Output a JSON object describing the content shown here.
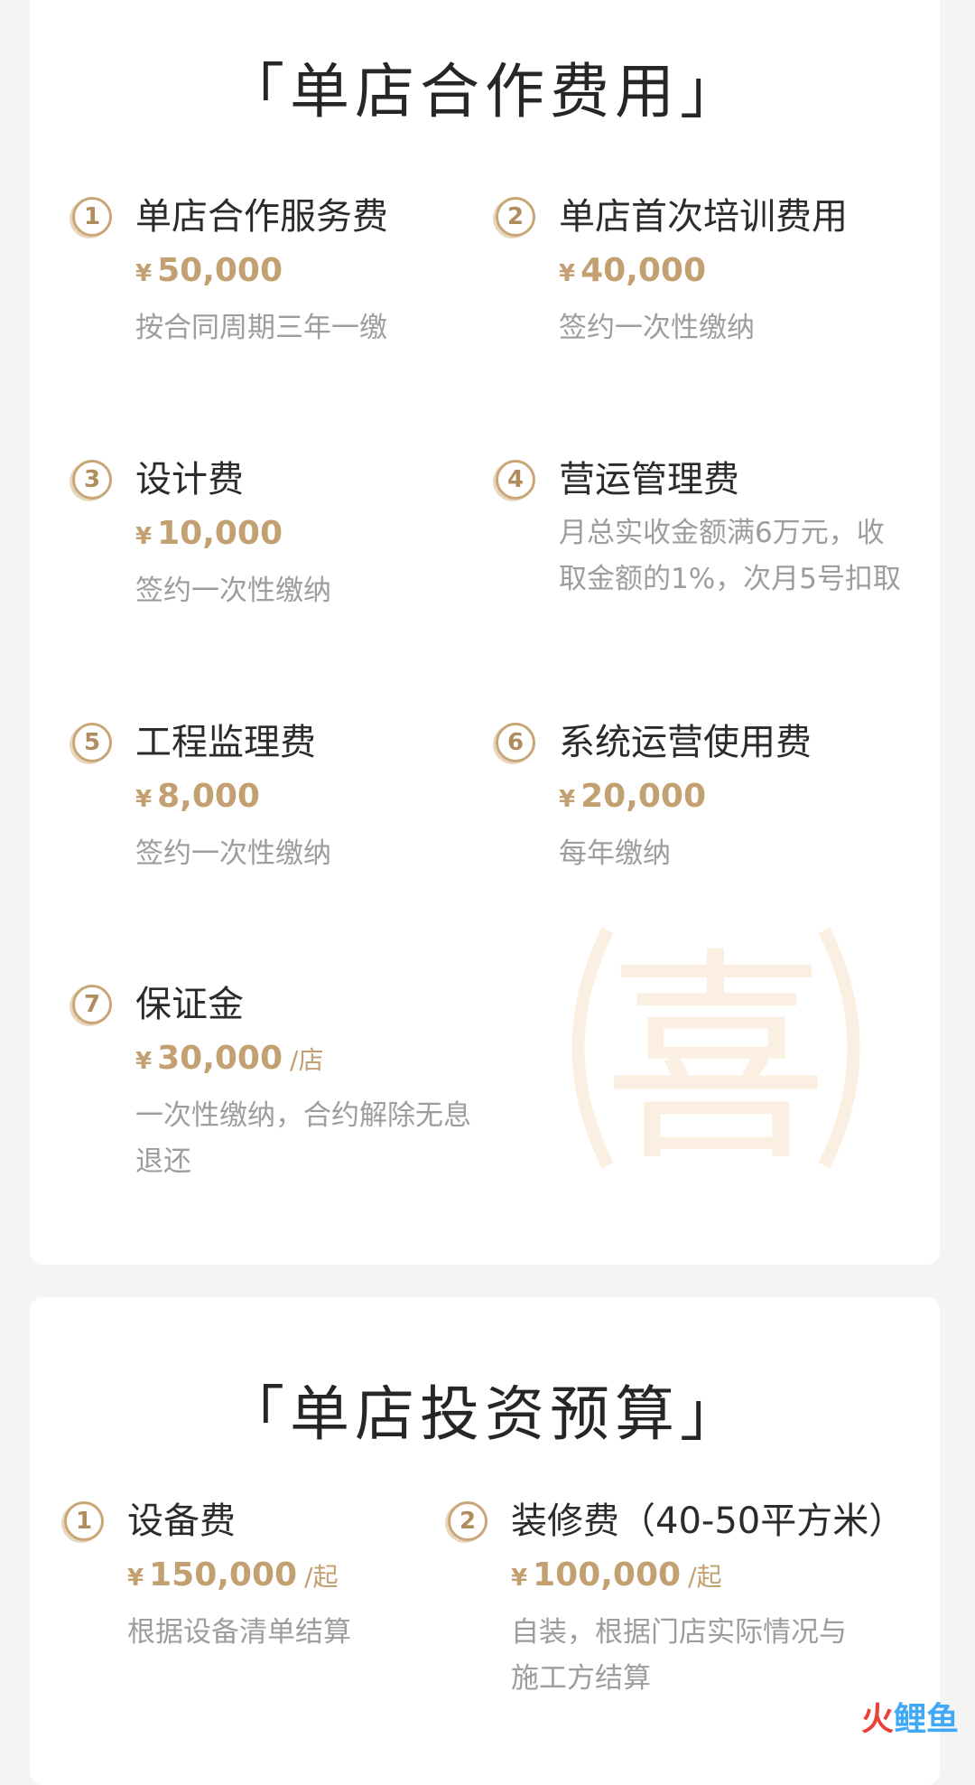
{
  "section1": {
    "title": "「单店合作费用」",
    "items": [
      {
        "num": "1",
        "title": "单店合作服务费",
        "yen": "¥",
        "price": "50,000",
        "unit": "",
        "desc": "按合同周期三年一缴"
      },
      {
        "num": "2",
        "title": "单店首次培训费用",
        "yen": "¥",
        "price": "40,000",
        "unit": "",
        "desc": "签约一次性缴纳"
      },
      {
        "num": "3",
        "title": "设计费",
        "yen": "¥",
        "price": "10,000",
        "unit": "",
        "desc": "签约一次性缴纳"
      },
      {
        "num": "4",
        "title": "营运管理费",
        "desc": "月总实收金额满6万元，收取金额的1%，次月5号扣取"
      },
      {
        "num": "5",
        "title": "工程监理费",
        "yen": "¥",
        "price": "8,000",
        "unit": "",
        "desc": "签约一次性缴纳"
      },
      {
        "num": "6",
        "title": "系统运营使用费",
        "yen": "¥",
        "price": "20,000",
        "unit": "",
        "desc": "每年缴纳"
      },
      {
        "num": "7",
        "title": "保证金",
        "yen": "¥",
        "price": "30,000",
        "unit": "/店",
        "desc": "一次性缴纳，合约解除无息退还"
      }
    ],
    "watermark_char": "喜"
  },
  "section2": {
    "title": "「单店投资预算」",
    "items": [
      {
        "num": "1",
        "title": "设备费",
        "yen": "¥",
        "price": "150,000",
        "unit": "/起",
        "desc": "根据设备清单结算"
      },
      {
        "num": "2",
        "title": "装修费（40-50平方米）",
        "yen": "¥",
        "price": "100,000",
        "unit": "/起",
        "desc": "自装，根据门店实际情况与施工方结算"
      }
    ]
  },
  "brand": {
    "logo_part1": "火",
    "logo_part2": "鲤鱼"
  },
  "colors": {
    "accent": "#c3a071",
    "title_text": "#2b2b2b",
    "desc_text": "#9d9d9d",
    "background": "#f4f4f4"
  }
}
